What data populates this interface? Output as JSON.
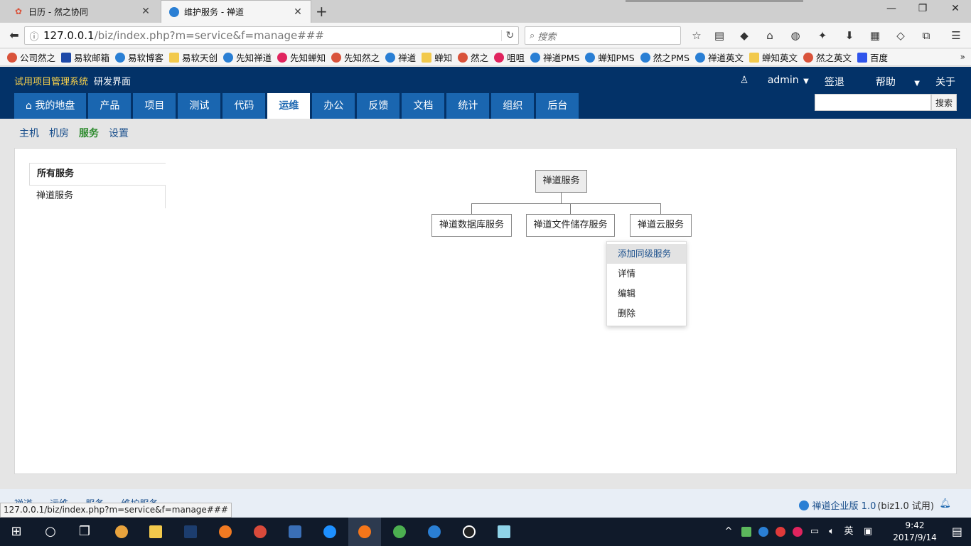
{
  "browser": {
    "tabs": [
      {
        "title": "日历 - 然之协同",
        "active": false
      },
      {
        "title": "维护服务 - 禅道",
        "active": true
      }
    ],
    "url_host": "127.0.0.1",
    "url_path": "/biz/index.php?m=service&f=manage###",
    "search_placeholder": "搜索",
    "status_url": "127.0.0.1/biz/index.php?m=service&f=manage###"
  },
  "bookmarks": [
    {
      "label": "公司然之",
      "icon": "fox"
    },
    {
      "label": "易软邮箱",
      "icon": "mail"
    },
    {
      "label": "易软博客",
      "icon": "blue"
    },
    {
      "label": "易软天创",
      "icon": "note"
    },
    {
      "label": "先知禅道",
      "icon": "blue"
    },
    {
      "label": "先知蝉知",
      "icon": "red"
    },
    {
      "label": "先知然之",
      "icon": "fox"
    },
    {
      "label": "禅道",
      "icon": "blue"
    },
    {
      "label": "蝉知",
      "icon": "note"
    },
    {
      "label": "然之",
      "icon": "fox"
    },
    {
      "label": "咀咀",
      "icon": "red"
    },
    {
      "label": "禅道PMS",
      "icon": "blue"
    },
    {
      "label": "蝉知PMS",
      "icon": "blue"
    },
    {
      "label": "然之PMS",
      "icon": "blue"
    },
    {
      "label": "禅道英文",
      "icon": "blue"
    },
    {
      "label": "蝉知英文",
      "icon": "note"
    },
    {
      "label": "然之英文",
      "icon": "fox"
    },
    {
      "label": "百度",
      "icon": "bd"
    }
  ],
  "app": {
    "brand": "试用项目管理系统",
    "subbrand": "研发界面",
    "user": "admin",
    "logout": "签退",
    "help": "帮助",
    "about": "关于",
    "nav": [
      {
        "label": "我的地盘",
        "active": false,
        "home": true
      },
      {
        "label": "产品",
        "active": false
      },
      {
        "label": "项目",
        "active": false
      },
      {
        "label": "测试",
        "active": false
      },
      {
        "label": "代码",
        "active": false
      },
      {
        "label": "运维",
        "active": true
      },
      {
        "label": "办公",
        "active": false
      },
      {
        "label": "反馈",
        "active": false
      },
      {
        "label": "文档",
        "active": false
      },
      {
        "label": "统计",
        "active": false
      },
      {
        "label": "组织",
        "active": false
      },
      {
        "label": "后台",
        "active": false
      }
    ],
    "search_button": "搜索"
  },
  "subnav": [
    {
      "label": "主机",
      "active": false
    },
    {
      "label": "机房",
      "active": false
    },
    {
      "label": "服务",
      "active": true
    },
    {
      "label": "设置",
      "active": false
    }
  ],
  "sidebar": [
    {
      "label": "所有服务",
      "active": true
    },
    {
      "label": "禅道服务",
      "active": false
    }
  ],
  "tree": {
    "root": "禅道服务",
    "children": [
      "禅道数据库服务",
      "禅道文件储存服务",
      "禅道云服务"
    ]
  },
  "context_menu": [
    {
      "label": "添加同级服务",
      "hover": true
    },
    {
      "label": "详情",
      "hover": false
    },
    {
      "label": "编辑",
      "hover": false
    },
    {
      "label": "删除",
      "hover": false
    }
  ],
  "footer": {
    "crumbs": [
      "禅道",
      "运维",
      "服务",
      "维护服务"
    ],
    "version_link": "禅道企业版 1.0",
    "version_note": "(biz1.0 试用)"
  },
  "taskbar": {
    "ime": "英",
    "time": "9:42",
    "date": "2017/9/14"
  },
  "colors": {
    "header_bg": "#033268",
    "nav_tab": "#1a66b0",
    "brand": "#ffd54a",
    "active_sub": "#2e8b2e"
  }
}
